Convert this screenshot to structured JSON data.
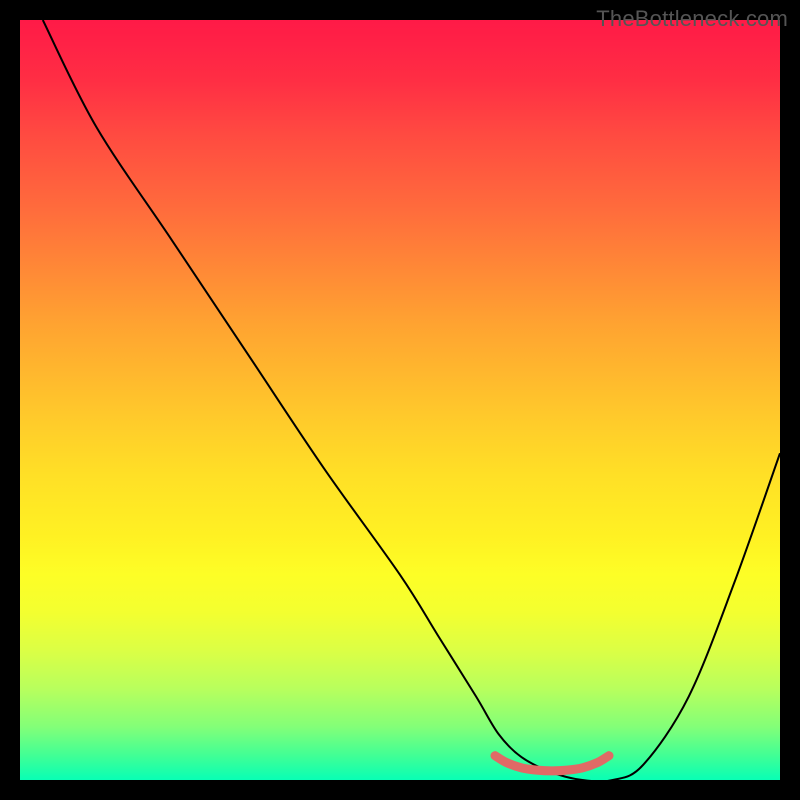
{
  "attribution": "TheBottleneck.com",
  "chart_data": {
    "type": "line",
    "title": "",
    "xlabel": "",
    "ylabel": "",
    "xlim": [
      0,
      100
    ],
    "ylim": [
      0,
      100
    ],
    "gradient_stops": [
      {
        "pos": 0,
        "color": "#ff1a47"
      },
      {
        "pos": 8,
        "color": "#ff2e44"
      },
      {
        "pos": 15,
        "color": "#ff4a41"
      },
      {
        "pos": 25,
        "color": "#ff6c3c"
      },
      {
        "pos": 40,
        "color": "#ffa331"
      },
      {
        "pos": 52,
        "color": "#ffc92b"
      },
      {
        "pos": 60,
        "color": "#ffe026"
      },
      {
        "pos": 68,
        "color": "#fff123"
      },
      {
        "pos": 73,
        "color": "#fdfe26"
      },
      {
        "pos": 78,
        "color": "#f3ff30"
      },
      {
        "pos": 83,
        "color": "#dbff45"
      },
      {
        "pos": 88,
        "color": "#b8ff5d"
      },
      {
        "pos": 93,
        "color": "#83ff78"
      },
      {
        "pos": 97,
        "color": "#3dff97"
      },
      {
        "pos": 100,
        "color": "#08ffb5"
      }
    ],
    "series": [
      {
        "name": "curve",
        "color": "#000000",
        "stroke_width": 2,
        "x": [
          3,
          10,
          20,
          30,
          40,
          50,
          55,
          60,
          63,
          66,
          70,
          74,
          78,
          82,
          88,
          94,
          100
        ],
        "y": [
          100,
          86,
          71,
          56,
          41,
          27,
          19,
          11,
          6,
          3,
          1,
          0,
          0,
          2,
          11,
          26,
          43
        ]
      },
      {
        "name": "marker-segment",
        "color": "#e06a66",
        "stroke_width": 9,
        "linecap": "round",
        "x": [
          62.5,
          64,
          66,
          68,
          70,
          72,
          74,
          76,
          77.5
        ],
        "y": [
          3.2,
          2.3,
          1.6,
          1.3,
          1.2,
          1.3,
          1.6,
          2.3,
          3.2
        ]
      }
    ]
  }
}
